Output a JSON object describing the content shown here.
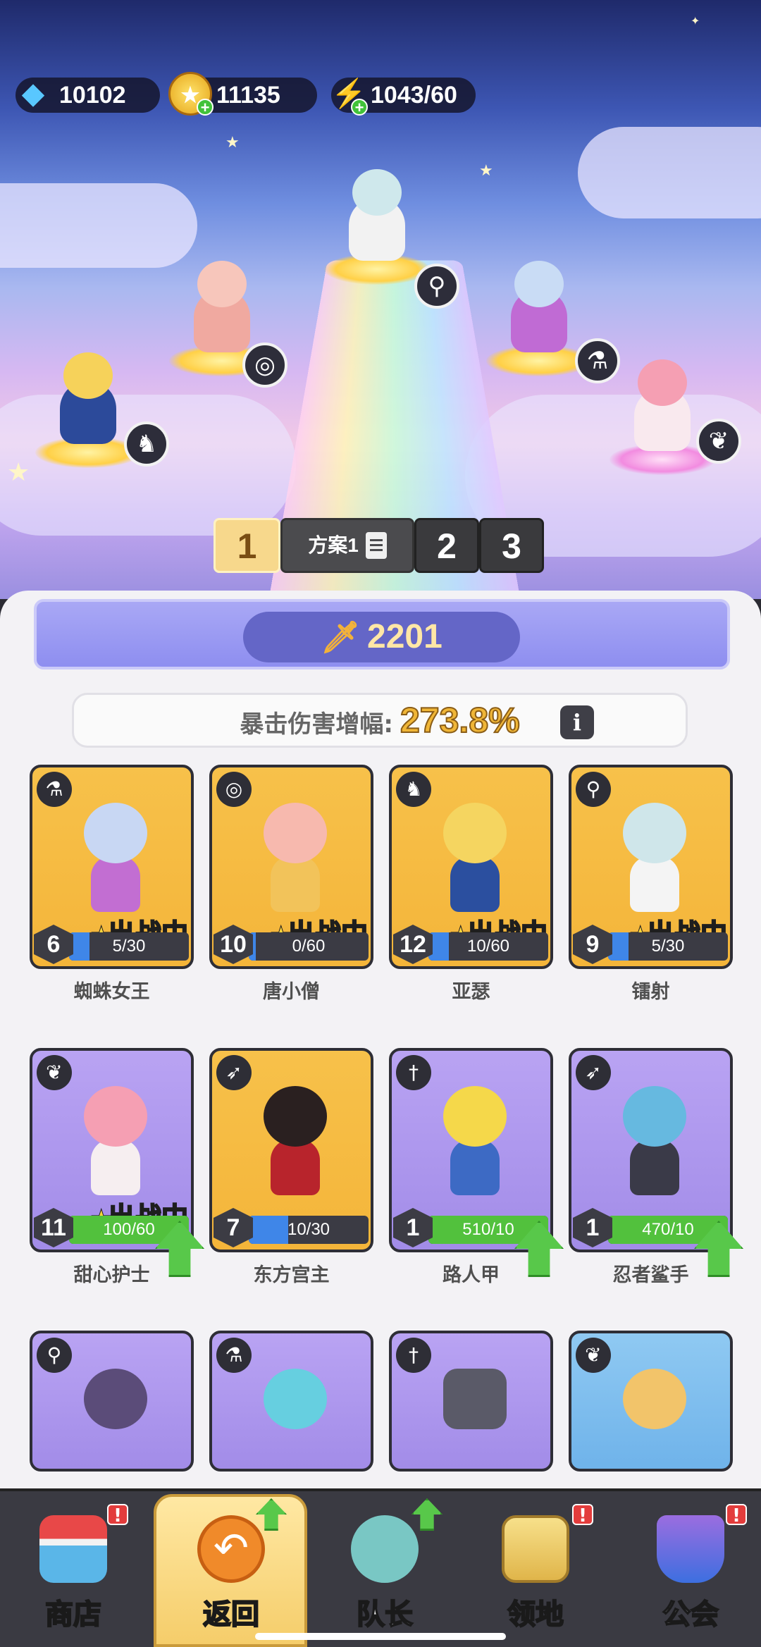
{
  "currency": {
    "gems": "10102",
    "coins": "11135",
    "energy": "1043/60"
  },
  "loadout": {
    "tab1": "1",
    "plan_label": "方案1",
    "tab2": "2",
    "tab3": "3"
  },
  "power": "2201",
  "crit": {
    "label": "暴击伤害增幅:",
    "value": "273.8%"
  },
  "deployed_label": "出战中",
  "heroes": [
    {
      "name": "蜘蛛女王",
      "level": "6",
      "progress": "5/30",
      "fraction": 0.17,
      "class_icon": "potion-icon",
      "deployed": true,
      "upgrade": false
    },
    {
      "name": "唐小僧",
      "level": "10",
      "progress": "0/60",
      "fraction": 0.0,
      "class_icon": "spiral-icon",
      "deployed": true,
      "upgrade": false
    },
    {
      "name": "亚瑟",
      "level": "12",
      "progress": "10/60",
      "fraction": 0.17,
      "class_icon": "helmet-icon",
      "deployed": true,
      "upgrade": false
    },
    {
      "name": "镭射",
      "level": "9",
      "progress": "5/30",
      "fraction": 0.17,
      "class_icon": "staff-icon",
      "deployed": true,
      "upgrade": false
    },
    {
      "name": "甜心护士",
      "level": "11",
      "progress": "100/60",
      "fraction": 1.0,
      "class_icon": "wings-icon",
      "deployed": true,
      "upgrade": true
    },
    {
      "name": "东方宫主",
      "level": "7",
      "progress": "10/30",
      "fraction": 0.33,
      "class_icon": "bow-icon",
      "deployed": false,
      "upgrade": false
    },
    {
      "name": "路人甲",
      "level": "1",
      "progress": "510/10",
      "fraction": 1.0,
      "class_icon": "sword-icon",
      "deployed": false,
      "upgrade": true
    },
    {
      "name": "忍者鲨手",
      "level": "1",
      "progress": "470/10",
      "fraction": 1.0,
      "class_icon": "bow-icon",
      "deployed": false,
      "upgrade": true
    }
  ],
  "nav": {
    "shop": "商店",
    "back": "返回",
    "captain": "队长",
    "territory": "领地",
    "guild": "公会"
  },
  "colors": {
    "card_gold": "#f4b53a",
    "card_purple": "#a28ce8",
    "progress_blue": "#3f86e8",
    "progress_green": "#52c13d",
    "power_text": "#ffe7a6",
    "crit_text": "#f0b637"
  }
}
